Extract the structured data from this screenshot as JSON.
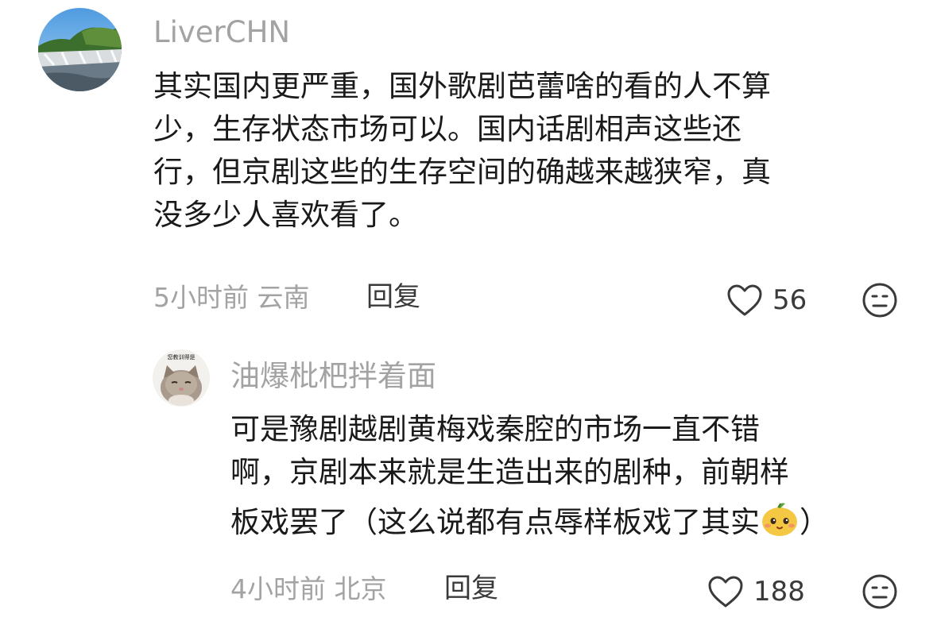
{
  "comments": [
    {
      "username": "LiverCHN",
      "lines": [
        "其实国内更严重，国外歌剧芭蕾啥的看的人不算",
        "少，生存状态市场可以。国内话剧相声这些还",
        "行，但京剧这些的生存空间的确越来越狭窄，真",
        "没多少人喜欢看了。"
      ],
      "meta": "5小时前 云南",
      "reply_label": "回复",
      "likes": "56",
      "avatar_icon": "waterfall-landscape-avatar"
    },
    {
      "username": "油爆枇杷拌着面",
      "lines": [
        "可是豫剧越剧黄梅戏秦腔的市场一直不错",
        "啊，京剧本来就是生造出来的剧种，前朝样",
        "板戏罢了（这么说都有点辱样板戏了其实",
        "）"
      ],
      "avatar_caption": "您教训得是",
      "meta": "4小时前 北京",
      "reply_label": "回复",
      "likes": "188",
      "emoji_icon": "shy-fruit-emoji",
      "avatar_icon": "cat-avatar"
    }
  ],
  "colors": {
    "text": "#1a1a1a",
    "secondary": "#a3a3a3",
    "action": "#3a3a3a"
  }
}
